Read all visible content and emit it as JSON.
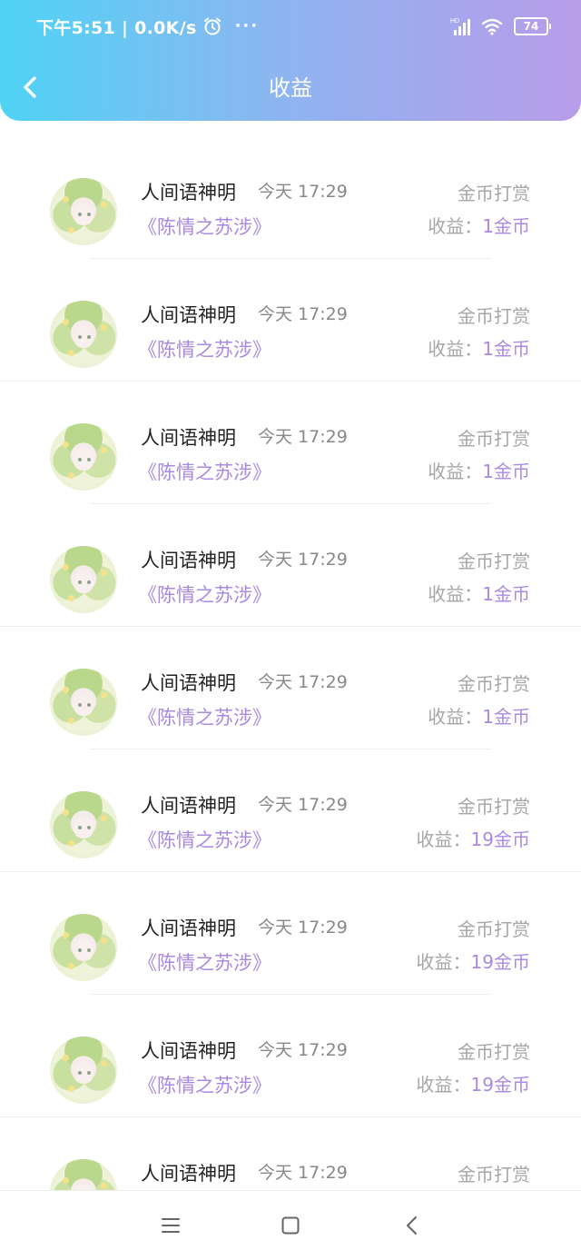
{
  "status_bar": {
    "time_network": "下午5:51 | 0.0K/s",
    "more": "···",
    "signal_label": "HD",
    "battery": "74"
  },
  "header": {
    "title": "收益"
  },
  "colors": {
    "gradient_start": "#4fd3f5",
    "gradient_end": "#b89be9",
    "accent": "#a98ae0",
    "muted": "#a6a6a6"
  },
  "records": [
    {
      "user": "人间语神明",
      "time": "今天 17:29",
      "book": "《陈情之苏涉》",
      "type": "金币打赏",
      "earning_label": "收益：",
      "earning_value": "1金币"
    },
    {
      "user": "人间语神明",
      "time": "今天 17:29",
      "book": "《陈情之苏涉》",
      "type": "金币打赏",
      "earning_label": "收益：",
      "earning_value": "1金币"
    },
    {
      "user": "人间语神明",
      "time": "今天 17:29",
      "book": "《陈情之苏涉》",
      "type": "金币打赏",
      "earning_label": "收益：",
      "earning_value": "1金币"
    },
    {
      "user": "人间语神明",
      "time": "今天 17:29",
      "book": "《陈情之苏涉》",
      "type": "金币打赏",
      "earning_label": "收益：",
      "earning_value": "1金币"
    },
    {
      "user": "人间语神明",
      "time": "今天 17:29",
      "book": "《陈情之苏涉》",
      "type": "金币打赏",
      "earning_label": "收益：",
      "earning_value": "1金币"
    },
    {
      "user": "人间语神明",
      "time": "今天 17:29",
      "book": "《陈情之苏涉》",
      "type": "金币打赏",
      "earning_label": "收益：",
      "earning_value": "19金币"
    },
    {
      "user": "人间语神明",
      "time": "今天 17:29",
      "book": "《陈情之苏涉》",
      "type": "金币打赏",
      "earning_label": "收益：",
      "earning_value": "19金币"
    },
    {
      "user": "人间语神明",
      "time": "今天 17:29",
      "book": "《陈情之苏涉》",
      "type": "金币打赏",
      "earning_label": "收益：",
      "earning_value": "19金币"
    },
    {
      "user": "人间语神明",
      "time": "今天 17:29",
      "book": "",
      "type": "金币打赏",
      "earning_label": "",
      "earning_value": ""
    }
  ],
  "nav_bar": {
    "icons": [
      "menu-icon",
      "home-square-icon",
      "back-triangle-icon"
    ]
  }
}
